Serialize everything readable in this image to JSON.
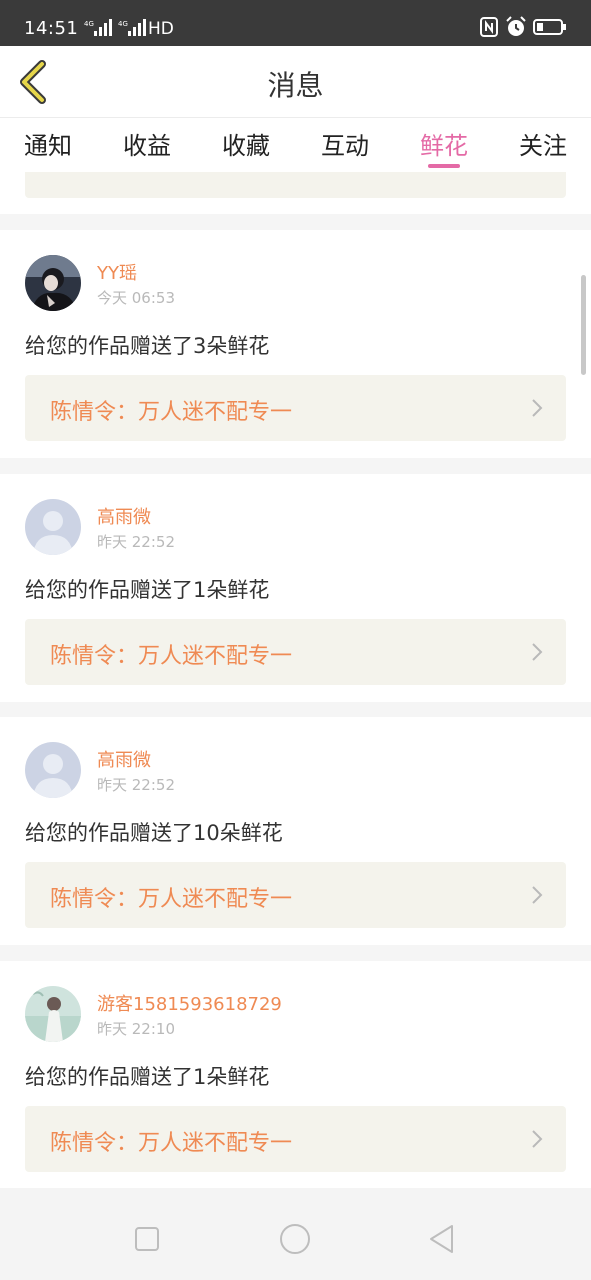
{
  "status_bar": {
    "time": "14:51",
    "hd": "HD",
    "icons": [
      "signal-4g-icon",
      "signal-4g-icon",
      "nfc-icon",
      "alarm-icon",
      "battery-icon"
    ]
  },
  "header": {
    "title": "消息",
    "back_icon": "chevron-left-icon",
    "accent": "#e6d64a"
  },
  "tabs": [
    {
      "label": "通知",
      "active": false
    },
    {
      "label": "收益",
      "active": false
    },
    {
      "label": "收藏",
      "active": false
    },
    {
      "label": "互动",
      "active": false
    },
    {
      "label": "鲜花",
      "active": true
    },
    {
      "label": "关注",
      "active": false
    }
  ],
  "colors": {
    "active_tab": "#e46aa6",
    "name": "#ef8a53",
    "work_bg": "#f4f3ec"
  },
  "messages": [
    {
      "user": "YY瑶",
      "time": "今天 06:53",
      "text": "给您的作品赠送了3朵鲜花",
      "work": "陈情令：万人迷不配专一",
      "avatar": "photo-avatar"
    },
    {
      "user": "高雨微",
      "time": "昨天 22:52",
      "text": "给您的作品赠送了1朵鲜花",
      "work": "陈情令：万人迷不配专一",
      "avatar": "default-avatar"
    },
    {
      "user": "高雨微",
      "time": "昨天 22:52",
      "text": "给您的作品赠送了10朵鲜花",
      "work": "陈情令：万人迷不配专一",
      "avatar": "default-avatar"
    },
    {
      "user": "游客1581593618729",
      "time": "昨天 22:10",
      "text": "给您的作品赠送了1朵鲜花",
      "work": "陈情令：万人迷不配专一",
      "avatar": "photo-avatar"
    }
  ],
  "nav_bar": {
    "buttons": [
      "recent-apps-icon",
      "home-icon",
      "back-icon"
    ]
  }
}
